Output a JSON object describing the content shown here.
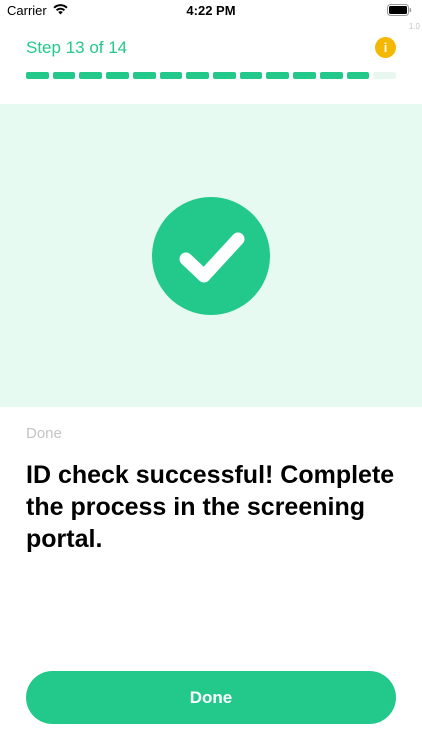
{
  "status_bar": {
    "carrier": "Carrier",
    "time": "4:22 PM",
    "icons": [
      "wifi-icon",
      "battery-icon"
    ]
  },
  "version_label": "1.0",
  "header": {
    "step_label": "Step 13 of 14",
    "info_icon_glyph": "i",
    "progress": {
      "current": 13,
      "total": 14
    }
  },
  "hero": {
    "icon": "checkmark-icon"
  },
  "content": {
    "eyebrow": "Done",
    "headline": "ID check successful! Complete the process in the screening portal."
  },
  "actions": {
    "done_label": "Done"
  },
  "colors": {
    "accent": "#22c98b",
    "hero_background": "#e6faf2",
    "info_badge": "#f5b800",
    "muted_text": "#c4c4c4"
  }
}
